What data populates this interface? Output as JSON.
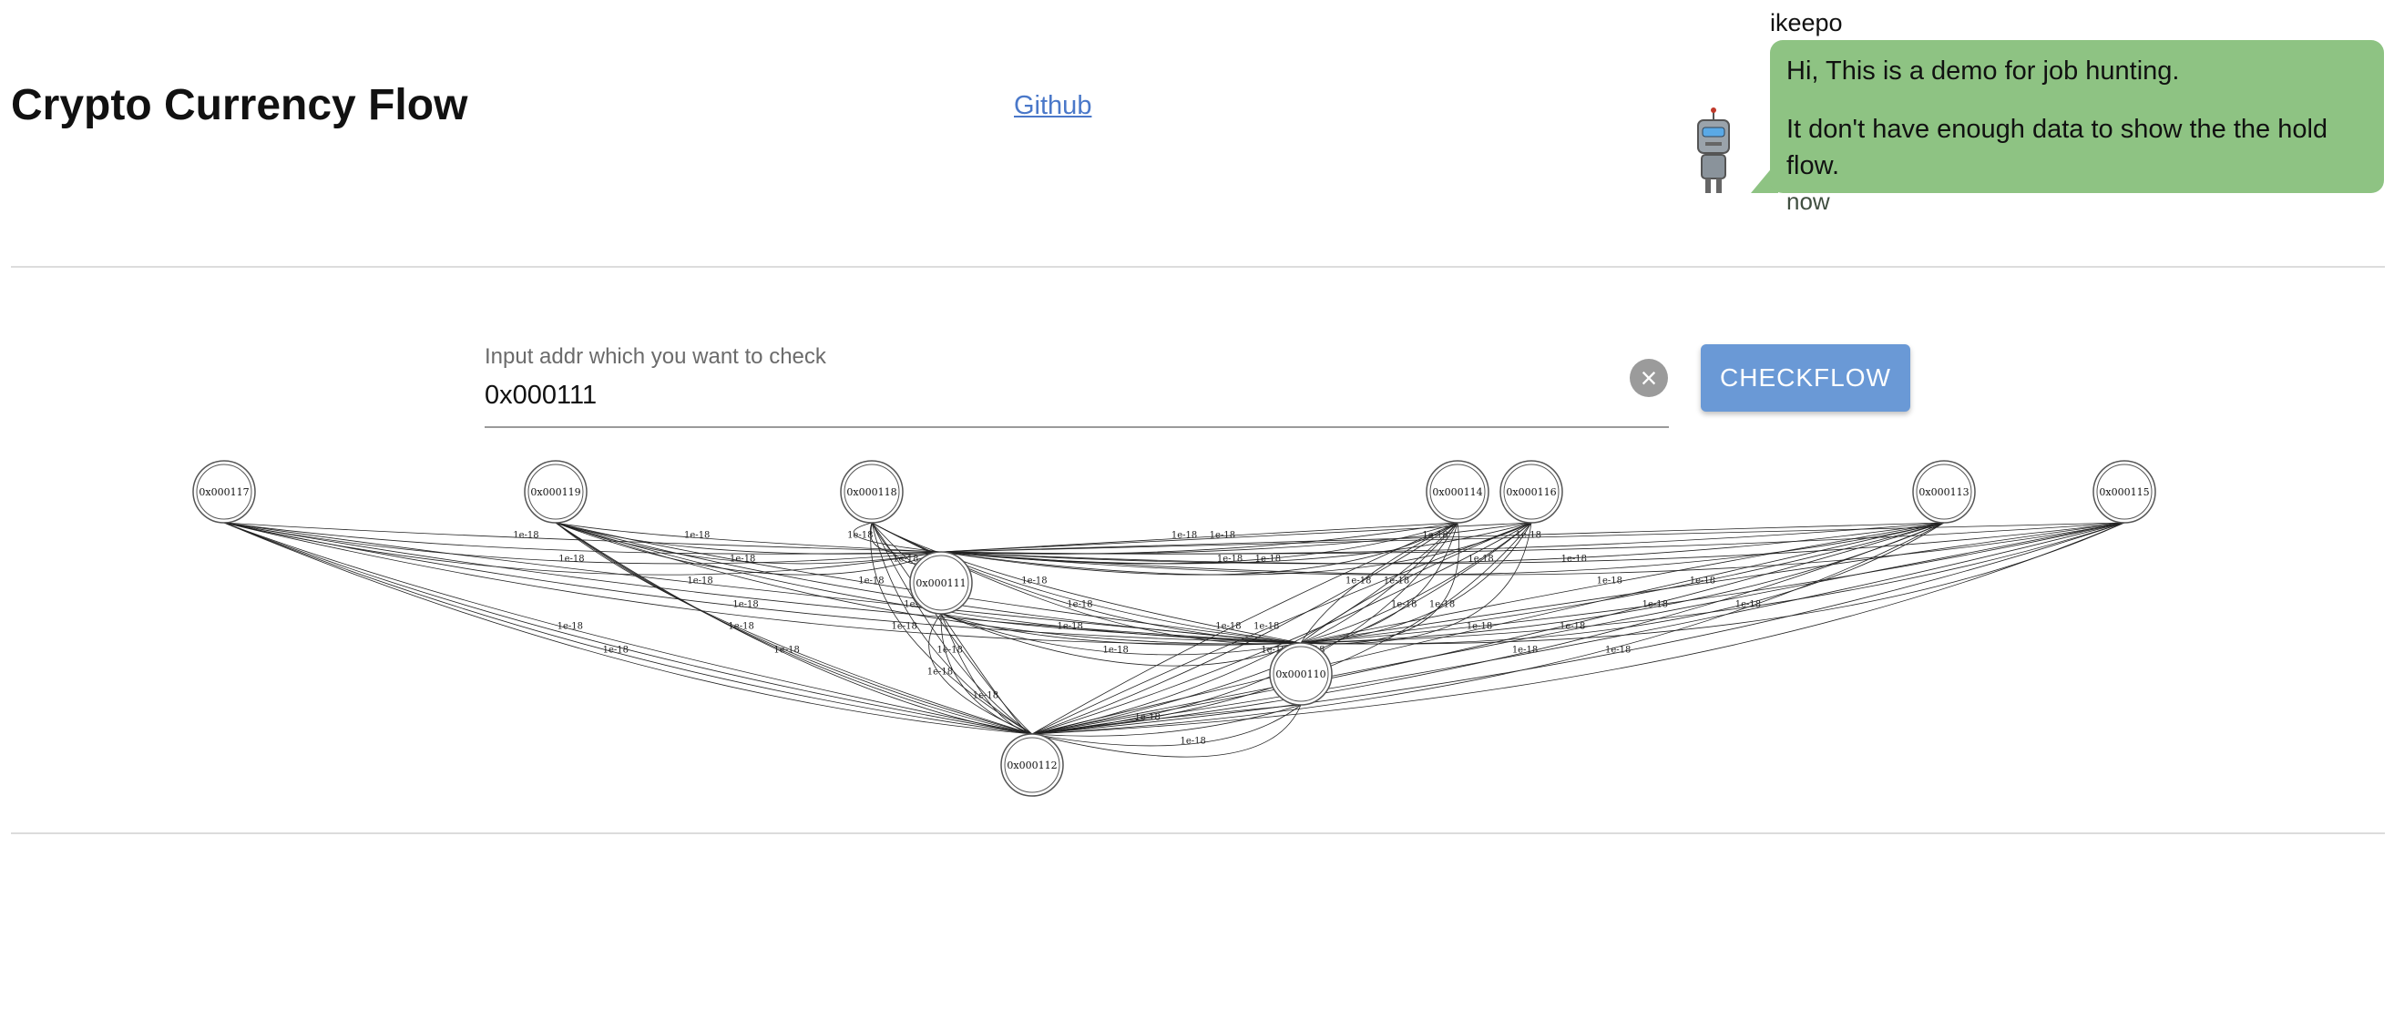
{
  "header": {
    "title": "Crypto Currency Flow",
    "github_link": "Github"
  },
  "chat": {
    "username": "ikeepo",
    "messages": [
      "Hi, This is a demo for job hunting.",
      "It don't have enough data to show the the hold flow."
    ],
    "time": "now",
    "bubble_color": "#8ec383"
  },
  "search": {
    "label": "Input addr which you want to check",
    "value": "0x000111",
    "clear_icon": "close-circle-icon",
    "button_label": "CHECKFLOW",
    "button_color": "#6a99d6"
  },
  "graph": {
    "nodes": [
      {
        "id": "0x000117",
        "label": "0x000117",
        "row": 0
      },
      {
        "id": "0x000119",
        "label": "0x000119",
        "row": 0
      },
      {
        "id": "0x000118",
        "label": "0x000118",
        "row": 0
      },
      {
        "id": "0x000114",
        "label": "0x000114",
        "row": 0
      },
      {
        "id": "0x000116",
        "label": "0x000116",
        "row": 0
      },
      {
        "id": "0x000113",
        "label": "0x000113",
        "row": 0
      },
      {
        "id": "0x000115",
        "label": "0x000115",
        "row": 0
      },
      {
        "id": "0x000111",
        "label": "0x000111",
        "row": 1
      },
      {
        "id": "0x000110",
        "label": "0x000110",
        "row": 2
      },
      {
        "id": "0x000112",
        "label": "0x000112",
        "row": 3
      }
    ],
    "edge_label": "1e-18",
    "edge_multiplicity": 4,
    "hubs": [
      "0x000111",
      "0x000110",
      "0x000112"
    ]
  }
}
